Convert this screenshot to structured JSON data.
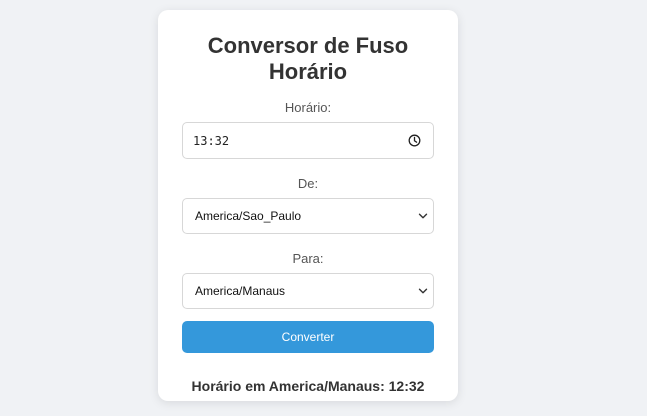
{
  "card": {
    "title": "Conversor de Fuso Horário",
    "time_label": "Horário:",
    "time_value": "13:32",
    "from_label": "De:",
    "from_value": "America/Sao_Paulo",
    "to_label": "Para:",
    "to_value": "America/Manaus",
    "convert_label": "Converter",
    "result": "Horário em America/Manaus: 12:32"
  },
  "colors": {
    "page_background": "#f0f2f5",
    "card_background": "#ffffff",
    "accent": "#3498db",
    "text": "#333333"
  },
  "icons": {
    "time_picker": "clock-icon",
    "select_arrow": "chevron-down-icon"
  }
}
